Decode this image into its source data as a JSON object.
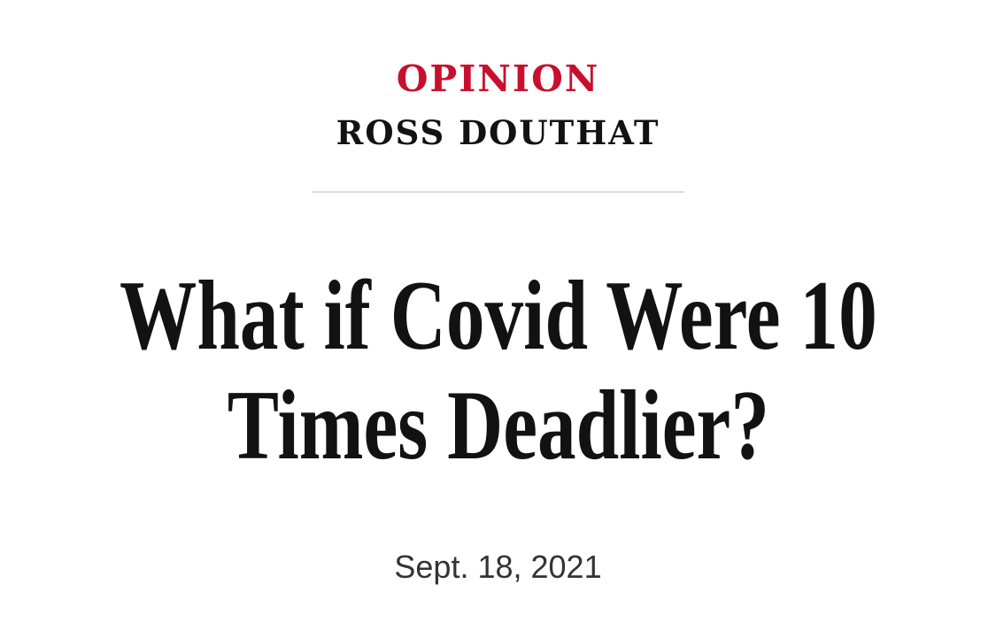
{
  "article_header": {
    "section": "OPINION",
    "columnist": "ROSS DOUTHAT",
    "headline": "What if Covid Were 10 Times Deadlier?",
    "date": "Sept. 18, 2021"
  },
  "colors": {
    "section_accent": "#c8102e",
    "text_primary": "#121212",
    "date_text": "#333333",
    "divider": "#dddddd",
    "background": "#ffffff"
  }
}
